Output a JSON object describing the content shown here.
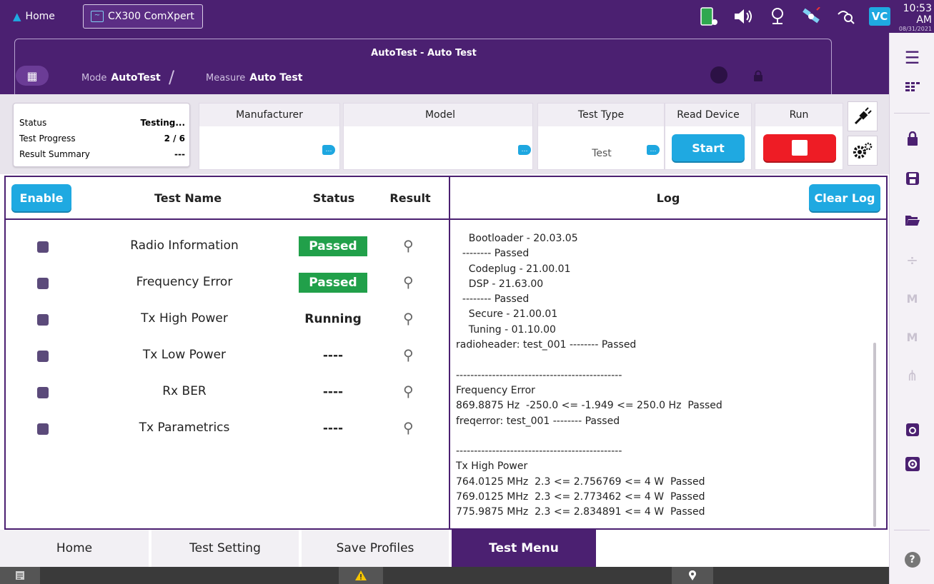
{
  "topbar": {
    "home_label": "Home",
    "app_tab_label": "CX300 ComXpert",
    "clock_time": "10:53 AM",
    "clock_date": "08/31/2021",
    "vnc_label": "VC"
  },
  "titlebar": {
    "title": "AutoTest - Auto Test",
    "mode_label": "Mode",
    "mode_value": "AutoTest",
    "measure_label": "Measure",
    "measure_value": "Auto Test"
  },
  "status_box": {
    "rows": [
      {
        "label": "Status",
        "value": "Testing..."
      },
      {
        "label": "Test Progress",
        "value": "2 / 6"
      },
      {
        "label": "Result Summary",
        "value": "---"
      }
    ]
  },
  "header": {
    "manufacturer_label": "Manufacturer",
    "model_label": "Model",
    "test_type_label": "Test Type",
    "test_type_value": "Test",
    "read_device_label": "Read Device",
    "start_label": "Start",
    "run_label": "Run"
  },
  "tests": {
    "enable_label": "Enable",
    "col_name": "Test Name",
    "col_status": "Status",
    "col_result": "Result",
    "rows": [
      {
        "name": "Radio Information",
        "status": "Passed"
      },
      {
        "name": "Frequency Error",
        "status": "Passed"
      },
      {
        "name": "Tx High Power",
        "status": "Running"
      },
      {
        "name": "Tx Low Power",
        "status": "----"
      },
      {
        "name": "Rx BER",
        "status": "----"
      },
      {
        "name": "Tx Parametrics",
        "status": "----"
      }
    ]
  },
  "log": {
    "title": "Log",
    "clear_label": "Clear Log",
    "lines": [
      "    Bootloader - 20.03.05",
      "  -------- Passed",
      "    Codeplug - 21.00.01",
      "    DSP - 21.63.00",
      "  -------- Passed",
      "    Secure - 21.00.01",
      "    Tuning - 01.10.00",
      "radioheader: test_001 -------- Passed",
      "",
      "----------------------------------------------",
      "Frequency Error",
      "869.8875 Hz  -250.0 <= -1.949 <= 250.0 Hz  Passed",
      "freqerror: test_001 -------- Passed",
      "",
      "----------------------------------------------",
      "Tx High Power",
      "764.0125 MHz  2.3 <= 2.756769 <= 4 W  Passed",
      "769.0125 MHz  2.3 <= 2.773462 <= 4 W  Passed",
      "775.9875 MHz  2.3 <= 2.834891 <= 4 W  Passed"
    ]
  },
  "bottom_nav": {
    "tabs": [
      "Home",
      "Test Setting",
      "Save Profiles",
      "Test Menu"
    ],
    "active": "Test Menu"
  },
  "colors": {
    "brand_purple": "#4b2071",
    "accent_blue": "#1fa9e1",
    "pass_green": "#21a04a",
    "run_red": "#ee1c25"
  }
}
